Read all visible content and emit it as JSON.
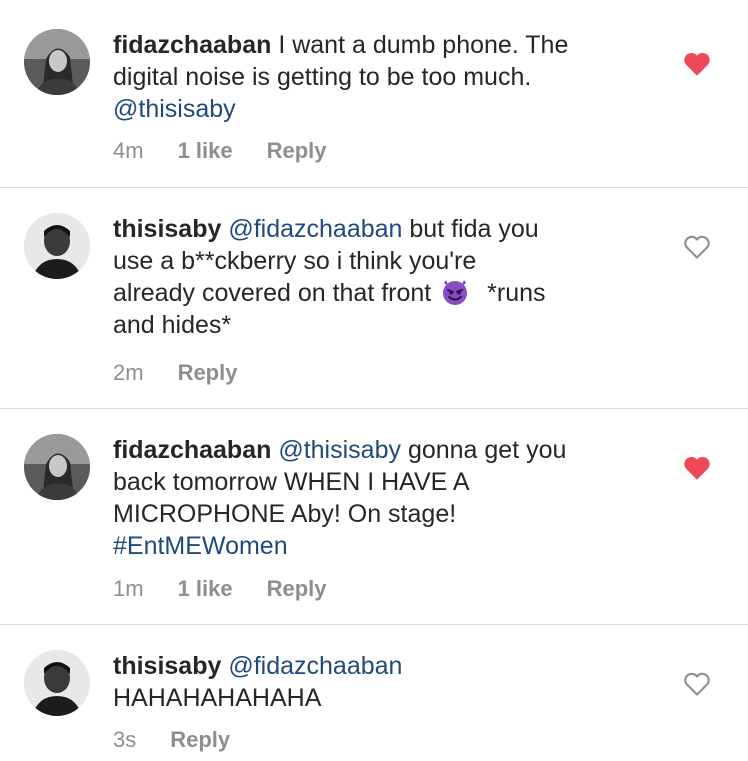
{
  "comments": [
    {
      "username": "fidazchaaban",
      "text_lines": [
        "I want a dumb phone. The",
        "digital noise is getting to be too much."
      ],
      "mention_line": "@thisisaby",
      "time": "4m",
      "likes": "1 like",
      "reply": "Reply",
      "liked": true
    },
    {
      "username": "thisisaby",
      "mention": "@fidazchaaban",
      "text_1": "but fida you",
      "text_2": "use a b**ckberry so i think you're",
      "text_3a": "already covered on that front",
      "emoji": "smiling-devil",
      "text_3b": "*runs",
      "text_4": "and hides*",
      "time": "2m",
      "reply": "Reply",
      "liked": false
    },
    {
      "username": "fidazchaaban",
      "mention": "@thisisaby",
      "text_1": "gonna get you",
      "text_2": "back tomorrow WHEN I HAVE A",
      "text_3": "MICROPHONE Aby! On stage!",
      "hashtag": "#EntMEWomen",
      "time": "1m",
      "likes": "1 like",
      "reply": "Reply",
      "liked": true
    },
    {
      "username": "thisisaby",
      "mention": "@fidazchaaban",
      "text_2": "HAHAHAHAHAHA",
      "time": "3s",
      "reply": "Reply",
      "liked": false
    }
  ],
  "colors": {
    "heart_liked": "#ed4956",
    "heart_empty": "#8e8e8e",
    "mention": "#1f4a7a",
    "meta": "#8e8e8e"
  }
}
